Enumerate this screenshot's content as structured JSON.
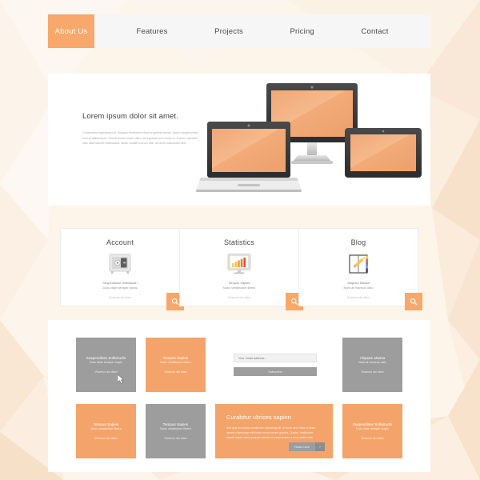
{
  "theme": {
    "accent": "#f7a86a",
    "accent_tile": "#f4a46a",
    "gray_tile": "#9d9d9d",
    "page_bg": "#fdf6ef",
    "panel": "#ffffff",
    "nav_bg": "#f6f6f6"
  },
  "nav": {
    "items": [
      {
        "label": "About Us",
        "active": true
      },
      {
        "label": "Features",
        "active": false
      },
      {
        "label": "Projects",
        "active": false
      },
      {
        "label": "Pricing",
        "active": false
      },
      {
        "label": "Contact",
        "active": false
      }
    ]
  },
  "hero": {
    "title": "Lorem ipsum dolor sit amet.",
    "body": "Consectetur adipiscing elit. Aliquam fermentum diam a gravida lacinia. Morbi volutpat porta sem at ullamcorper. Duis tincidunt metus diam, vel egestas orci rutrum in. Donec vulputate odio vitae laoreet malesuada. Morbi sodales rutrum nibh, sit amet sollicitudin nibh.",
    "devices": [
      "desktop-monitor",
      "laptop",
      "tablet"
    ]
  },
  "cards": [
    {
      "title": "Account",
      "icon": "safe-vault-icon",
      "sub_line1": "Suspendisse Sollicitudin",
      "sub_line2": "Duis vitae semper turpis",
      "meta": "Vivamus dui diam",
      "search_icon": "magnifier-icon"
    },
    {
      "title": "Statistics",
      "icon": "monitor-bar-chart-icon",
      "sub_line1": "Tempus Sapien",
      "sub_line2": "Nunc vestibulum libero",
      "meta": "Vivamus dui diam",
      "search_icon": "magnifier-icon"
    },
    {
      "title": "Blog",
      "icon": "notebook-pencil-icon",
      "sub_line1": "Aliquam Massa",
      "sub_line2": "Nam at rhoncus odio",
      "meta": "Vivamus dui diam",
      "search_icon": "magnifier-icon"
    }
  ],
  "grid": {
    "tiles": [
      {
        "id": "t-a",
        "color": "gray",
        "line1": "Suspendisse Sollicitudin",
        "line2": "Duis vitae semper turpis",
        "line3": "Vivamus dui diam",
        "cursor": true
      },
      {
        "id": "t-b",
        "color": "orange",
        "line1": "Tempus Sapien",
        "line2": "Nunc vestibulum libero",
        "line3": "Vivamus dui diam",
        "cursor": false
      },
      {
        "id": "t-c",
        "color": "gray",
        "line1": "Aliquam Massa",
        "line2": "Nam at rhoncus odio",
        "line3": "Vivamus dui diam",
        "cursor": false
      },
      {
        "id": "t-d",
        "color": "orange",
        "line1": "Tempus Sapien",
        "line2": "Nunc vestibulum libero",
        "line3": "Vivamus dui diam",
        "cursor": false
      },
      {
        "id": "t-e",
        "color": "gray",
        "line1": "Tempus Sapien",
        "line2": "Nunc vestibulum libero",
        "line3": "Vivamus dui diam",
        "cursor": false
      },
      {
        "id": "t-f",
        "color": "orange",
        "line1": "Suspendisse Sollicitudin",
        "line2": "Duis vitae semper turpis",
        "line3": "Vivamus dui diam",
        "cursor": false
      }
    ]
  },
  "newsletter": {
    "placeholder": "Your email address...",
    "button_label": "Subscribe"
  },
  "promo": {
    "title": "Curabitur ultrices sapien",
    "body": "Sed quis leo cursus vestibulum adipiscing elit. Ut tortor sed. Nulla ut lorem laoreet ullamcorper elit fusce cursus ornare gravida. Curabit. Vestibulum blandit turpis cursus posuere dictum id condimentum a eros mattis nulla.",
    "button_label": "Read more",
    "button_arrow": "chevron-right-icon"
  }
}
